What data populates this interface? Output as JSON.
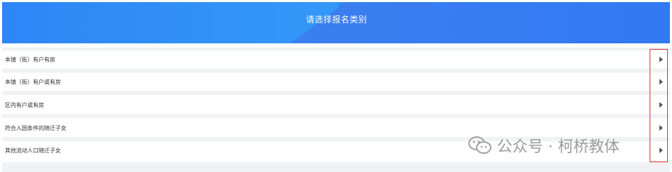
{
  "header": {
    "title": "请选择报名类别"
  },
  "categories": [
    {
      "label": "本镇（街）有户有房"
    },
    {
      "label": "本镇（街）有户或有房"
    },
    {
      "label": "区内有户或有房"
    },
    {
      "label": "符合入园条件的随迁子女"
    },
    {
      "label": "其他流动人口随迁子女"
    }
  ],
  "watermark": {
    "text": "公众号 · 柯桥教体"
  },
  "colors": {
    "header_blue": "#2f8af5",
    "highlight_red": "#e0302a",
    "row_gap": "#f1f2f5"
  }
}
